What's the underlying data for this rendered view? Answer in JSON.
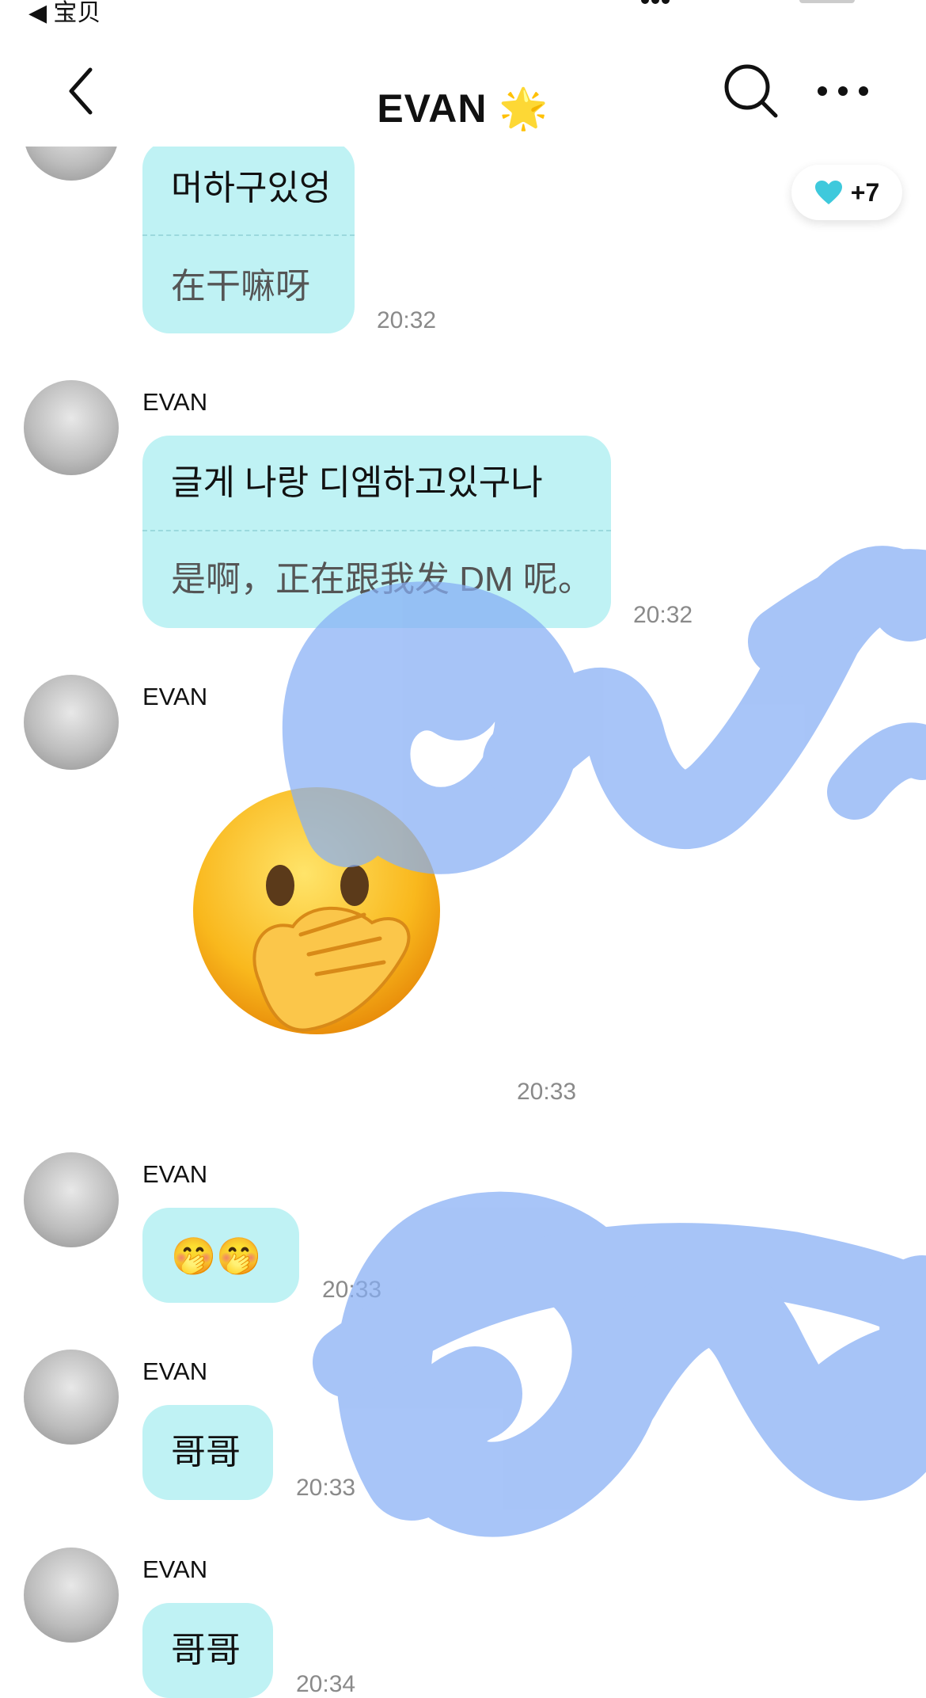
{
  "status": {
    "back_label": "◀ 宝贝"
  },
  "header": {
    "title": "EVAN 🌟",
    "back_icon": "chevron-left-icon",
    "search_icon": "search-icon",
    "more_icon": "more-dots-icon"
  },
  "badge": {
    "icon": "heart-icon",
    "count": "+7",
    "color": "#3ec9dc"
  },
  "messages": [
    {
      "sender": "",
      "ko": "머하구있엉",
      "zh": "在干嘛呀",
      "time": "20:32"
    },
    {
      "sender": "EVAN",
      "ko": "글게 나랑 디엠하고있구나",
      "zh": "是啊，正在跟我发 DM 呢。",
      "time": "20:32"
    },
    {
      "sender": "EVAN",
      "emoji": "🤭",
      "time": "20:33"
    },
    {
      "sender": "EVAN",
      "text": "🤭🤭",
      "time": "20:33"
    },
    {
      "sender": "EVAN",
      "text": "哥哥",
      "time": "20:33"
    },
    {
      "sender": "EVAN",
      "text": "哥哥",
      "time": "20:34"
    }
  ],
  "colors": {
    "bubble": "#bff2f4",
    "scribble": "#86aef5"
  }
}
